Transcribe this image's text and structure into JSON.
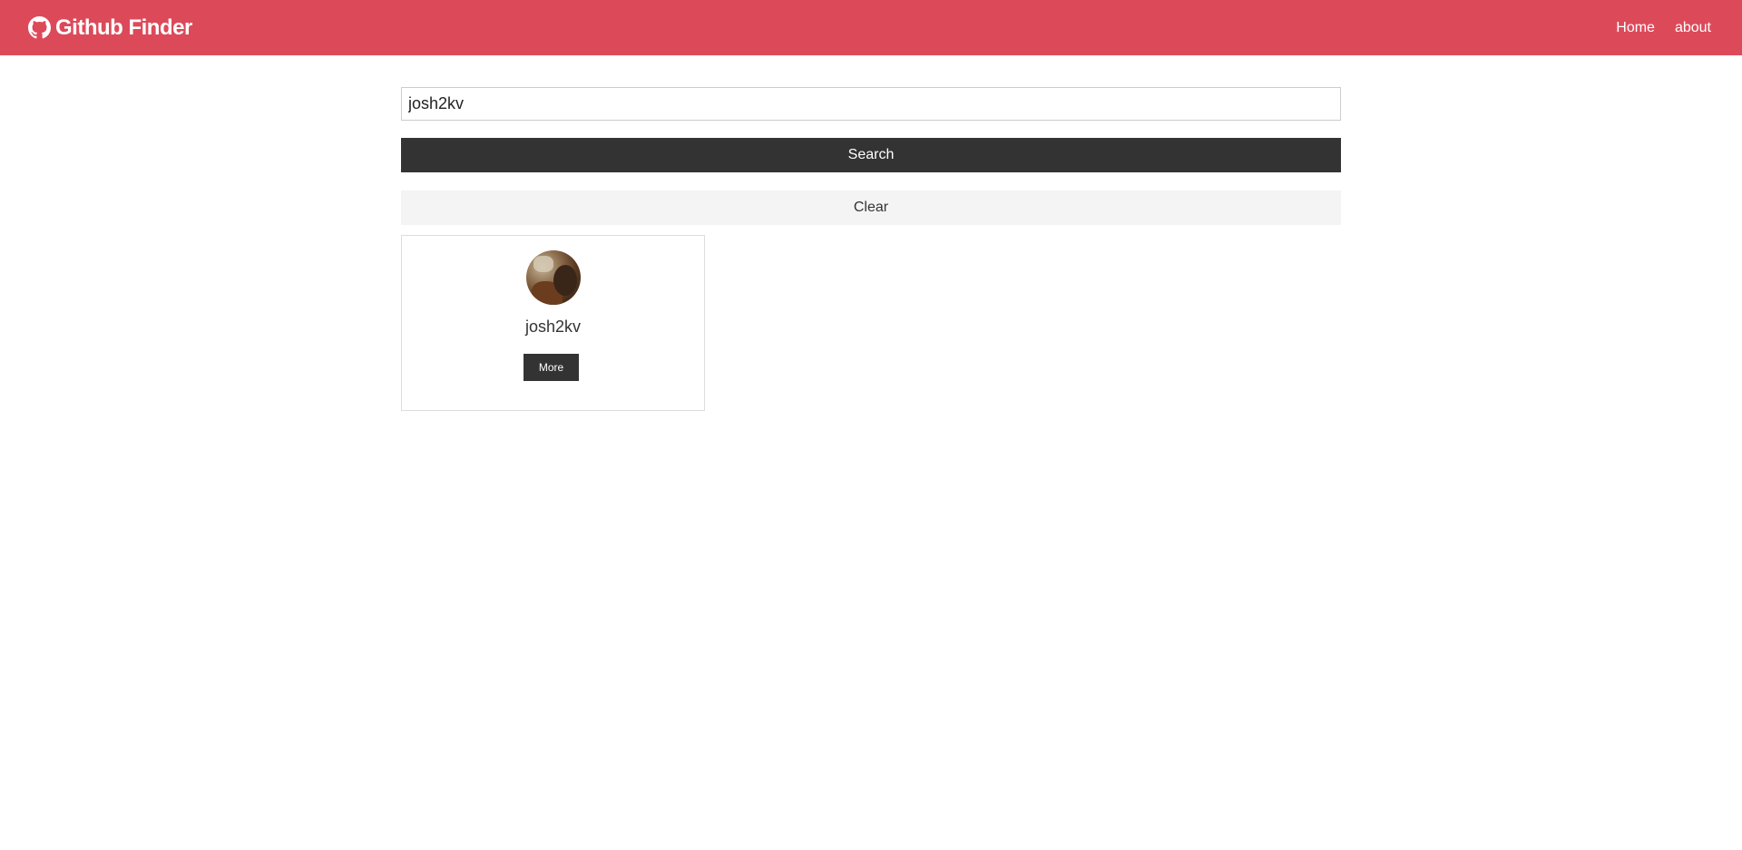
{
  "navbar": {
    "brand_icon": "github-icon",
    "brand_title": "Github Finder",
    "links": [
      {
        "label": "Home"
      },
      {
        "label": "about"
      }
    ],
    "background_color": "#dc4a5a"
  },
  "search": {
    "input_value": "josh2kv",
    "search_label": "Search",
    "clear_label": "Clear"
  },
  "results": [
    {
      "avatar": "user-avatar-photo",
      "login": "josh2kv",
      "more_label": "More"
    }
  ]
}
